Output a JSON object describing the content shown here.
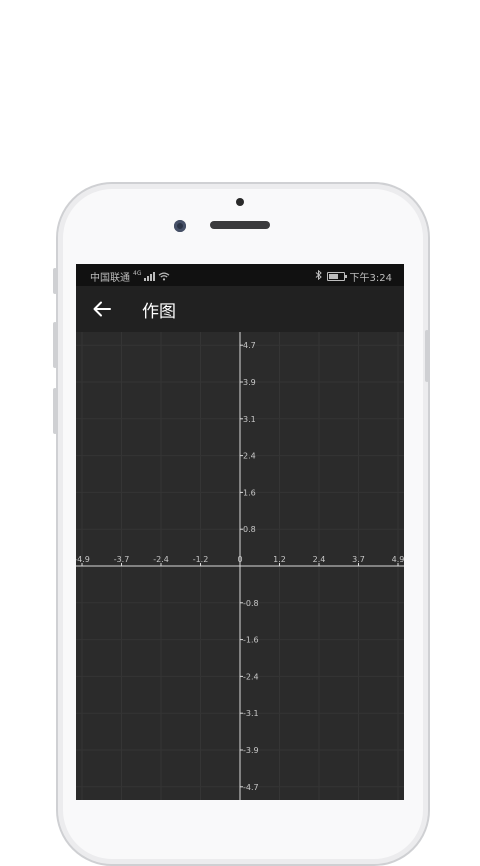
{
  "statusbar": {
    "carrier": "中国联通",
    "network_type": "4G",
    "time": "下午3:24",
    "icons": [
      "signal-icon",
      "wifi-icon",
      "bluetooth-icon",
      "battery-icon"
    ]
  },
  "appbar": {
    "title": "作图",
    "back_icon": "arrow-left-icon"
  },
  "graph": {
    "x_ticks": [
      "-4.9",
      "-3.7",
      "-2.4",
      "-1.2",
      "0",
      "1.2",
      "2.4",
      "3.7",
      "4.9"
    ],
    "y_ticks": [
      "4.7",
      "3.9",
      "3.1",
      "2.4",
      "1.6",
      "0.8",
      "0",
      "-0.8",
      "-1.6",
      "-2.4",
      "-3.1",
      "-3.9",
      "-4.7"
    ],
    "colors": {
      "background": "#2b2b2b",
      "axis": "#d9d9d9",
      "grid": "#353535"
    }
  },
  "phone": {
    "frame_color": "#cfd0d3"
  }
}
